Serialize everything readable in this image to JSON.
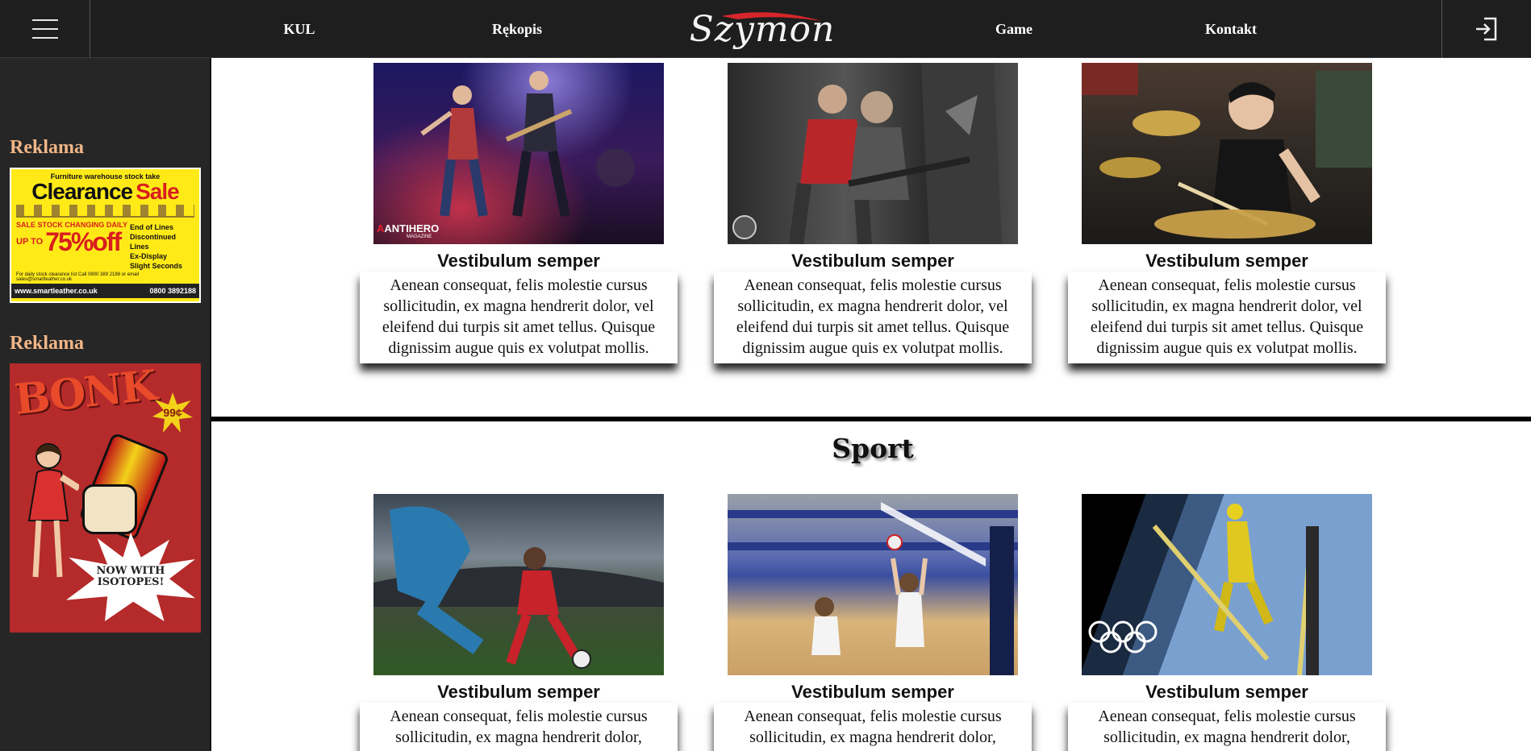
{
  "header": {
    "nav": [
      "KUL",
      "Rękopis",
      "Game",
      "Kontakt"
    ],
    "logo_text": "Szymon"
  },
  "sidebar": {
    "ads": [
      {
        "title": "Reklama",
        "banner": {
          "top": "Furniture warehouse stock take",
          "headline_1": "Clearance",
          "headline_2": "Sale",
          "stock": "SALE STOCK CHANGING DAILY",
          "up_to": "UP TO",
          "discount": "75%off",
          "bullets": [
            "End of Lines",
            "Discontinued Lines",
            "Ex-Display",
            "Slight Seconds"
          ],
          "footer": "For daily stock clearance list Call 0800 389 2188 or email sales@smartleather.co.uk",
          "website": "www.smartleather.co.uk",
          "phone": "0800 3892188"
        }
      },
      {
        "title": "Reklama",
        "banner": {
          "brand": "BONK",
          "price": "99¢",
          "tagline_1": "NOW WITH",
          "tagline_2": "ISOTOPES!"
        }
      }
    ]
  },
  "main": {
    "top_cards": [
      {
        "title": "Vestibulum semper",
        "text": "Aenean consequat, felis molestie cursus sollicitudin, ex magna hendrerit dolor, vel eleifend dui turpis sit amet tellus. Quisque dignissim augue quis ex volutpat mollis.",
        "image": "band-concert-photo"
      },
      {
        "title": "Vestibulum semper",
        "text": "Aenean consequat, felis molestie cursus sollicitudin, ex magna hendrerit dolor, vel eleifend dui turpis sit amet tellus. Quisque dignissim augue quis ex volutpat mollis.",
        "image": "singer-guitarist-photo"
      },
      {
        "title": "Vestibulum semper",
        "text": "Aenean consequat, felis molestie cursus sollicitudin, ex magna hendrerit dolor, vel eleifend dui turpis sit amet tellus. Quisque dignissim augue quis ex volutpat mollis.",
        "image": "drummer-photo"
      }
    ],
    "section_title": "Sport",
    "sport_cards": [
      {
        "title": "Vestibulum semper",
        "text": "Aenean consequat, felis molestie cursus sollicitudin, ex magna hendrerit dolor,",
        "image": "football-photo"
      },
      {
        "title": "Vestibulum semper",
        "text": "Aenean consequat, felis molestie cursus sollicitudin, ex magna hendrerit dolor,",
        "image": "volleyball-photo"
      },
      {
        "title": "Vestibulum semper",
        "text": "Aenean consequat, felis molestie cursus sollicitudin, ex magna hendrerit dolor,",
        "image": "ski-jumper-photo"
      }
    ],
    "watermark_1": "ANTIHERO",
    "watermark_2": "MAGAZINE"
  },
  "colors": {
    "topbar": "#1e1e1e",
    "sidebar": "#262626",
    "ad_title": "#f1b687"
  }
}
